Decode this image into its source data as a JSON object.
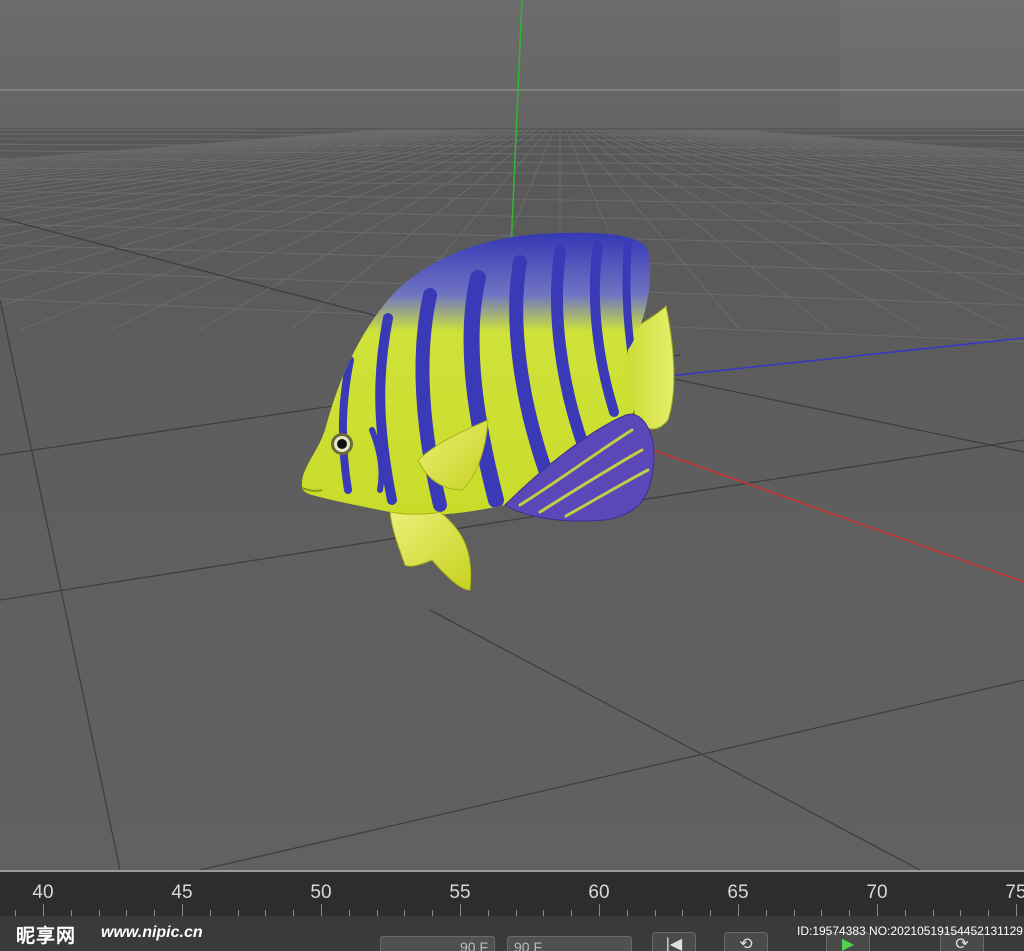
{
  "timeline": {
    "ticks": [
      "40",
      "45",
      "50",
      "55",
      "60",
      "65",
      "70",
      "75"
    ]
  },
  "controls": {
    "frame_start": "90 F",
    "frame_end": "90 F",
    "btn_first": "|◀",
    "btn_prev": "⟲",
    "btn_play": "▶",
    "btn_next": "⟳"
  },
  "watermark": {
    "logo": "昵享网",
    "url": "www.nipic.cn",
    "id": "ID:19574383 NO:20210519154452131129"
  },
  "colors": {
    "sky": "#6a6a6a",
    "floor": "#5d5d5d",
    "axis_x": "#d03030",
    "axis_y": "#2fb82f",
    "axis_z": "#3636c8",
    "fish_yellow": "#d6e830",
    "fish_blue": "#3a3ab8"
  }
}
